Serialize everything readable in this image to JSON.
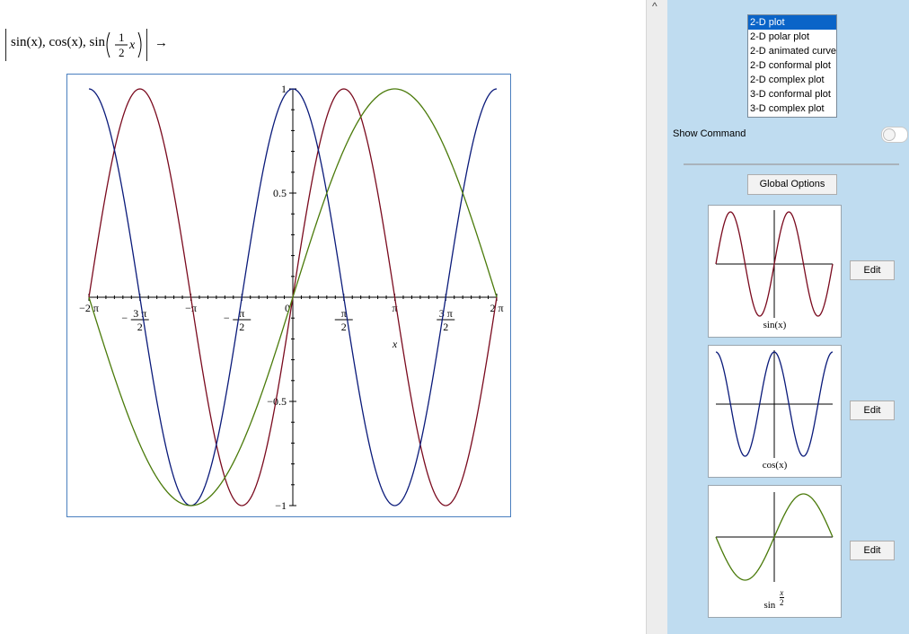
{
  "expression": {
    "prefix": "sin(x), cos(x), sin",
    "frac_num": "1",
    "frac_den": "2",
    "var": "x",
    "arrow": "→"
  },
  "plot": {
    "x_ticks": [
      {
        "num": "−2 π",
        "den": ""
      },
      {
        "num": "3 π",
        "den": "2",
        "sign": "−"
      },
      {
        "num": "−π",
        "den": ""
      },
      {
        "num": "π",
        "den": "2",
        "sign": "−"
      },
      {
        "num": "0",
        "den": ""
      },
      {
        "num": "π",
        "den": "2"
      },
      {
        "num": "π",
        "den": ""
      },
      {
        "num": "3 π",
        "den": "2"
      },
      {
        "num": "2 π",
        "den": ""
      }
    ],
    "y_ticks": [
      "1",
      "0.5",
      "−0.5",
      "−1"
    ],
    "x_axis_label": "x",
    "colors": {
      "sin": "#7a0a1e",
      "cos": "#0a1a7a",
      "sin_half": "#4a7a0a",
      "frame": "#4a7fbf"
    }
  },
  "chart_data": {
    "type": "line",
    "xlabel": "x",
    "xlim": [
      -6.2832,
      6.2832
    ],
    "ylim": [
      -1,
      1
    ],
    "series": [
      {
        "name": "sin(x)",
        "function": "sin(x)"
      },
      {
        "name": "cos(x)",
        "function": "cos(x)"
      },
      {
        "name": "sin(x/2)",
        "function": "sin(x/2)"
      }
    ]
  },
  "side_panel": {
    "plot_types": [
      "2-D plot",
      "2-D polar plot",
      "2-D animated curve",
      "2-D conformal plot",
      "2-D complex plot",
      "3-D conformal plot",
      "3-D complex plot"
    ],
    "selected_index": 0,
    "show_command_label": "Show Command",
    "show_command_on": false,
    "global_options_label": "Global Options",
    "thumbnails": [
      {
        "label": "sin(x)",
        "edit_label": "Edit"
      },
      {
        "label": "cos(x)",
        "edit_label": "Edit"
      },
      {
        "label_prefix": "sin",
        "frac_num": "x",
        "frac_den": "2",
        "edit_label": "Edit"
      }
    ]
  },
  "splitter": {
    "arrow_icon": "chevron-up-icon",
    "arrow_glyph": "^"
  }
}
